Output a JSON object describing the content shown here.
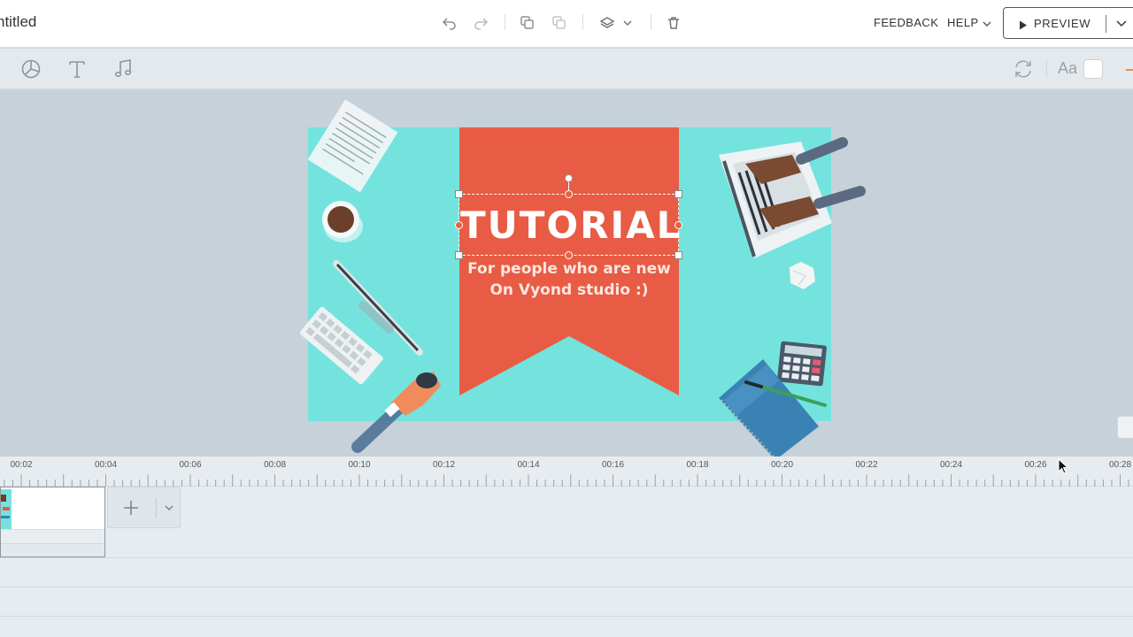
{
  "app": {
    "title": "ntitled"
  },
  "toolbar": {
    "feedback_label": "FEEDBACK",
    "help_label": "HELP",
    "preview_label": "PREVIEW",
    "icons": [
      "undo-icon",
      "redo-icon",
      "copy-icon",
      "paste-icon",
      "layers-icon",
      "chevron-down-icon",
      "trash-icon"
    ]
  },
  "subtoolbar": {
    "icons": [
      "chart-icon",
      "text-icon",
      "music-icon",
      "swap-icon"
    ],
    "font_label": "Aa",
    "color_value": "#ffffff"
  },
  "scene": {
    "title_text": "TUTORIAL",
    "subtitle_line1": "For people who are new",
    "subtitle_line2": "On Vyond studio :)",
    "background_color": "#74e3dd",
    "banner_color": "#e85c45"
  },
  "timeline": {
    "ticks": [
      "00:02",
      "00:04",
      "00:06",
      "00:08",
      "00:10",
      "00:12",
      "00:14",
      "00:16",
      "00:18",
      "00:20",
      "00:22",
      "00:24",
      "00:26",
      "00:28"
    ]
  },
  "colors": {
    "accent": "#f08c3c",
    "handle": "#e8623f"
  }
}
